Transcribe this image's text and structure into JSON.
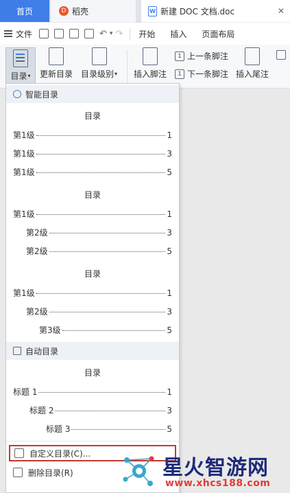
{
  "tabs": {
    "home": "首页",
    "daoke": "稻壳",
    "daoke_logo": "D",
    "doc": "新建 DOC 文档.doc",
    "doc_icon": "W",
    "close": "✕"
  },
  "menubar": {
    "file": "文件",
    "undo": "↶",
    "redo": "↷",
    "dropdown": "▾",
    "start": "开始",
    "insert": "插入",
    "page_layout": "页面布局"
  },
  "ribbon": {
    "toc": "目录",
    "toc_arrow": "▾",
    "update_toc": "更新目录",
    "toc_level": "目录级别",
    "toc_level_arrow": "▾",
    "insert_footnote": "插入脚注",
    "prev_footnote": "上一条脚注",
    "next_footnote": "下一条脚注",
    "insert_endnote": "插入尾注",
    "fn_icon": "1"
  },
  "dropdown": {
    "smart_toc_header": "智能目录",
    "auto_toc_header": "自动目录",
    "sample1": {
      "title": "目录",
      "lines": [
        {
          "label": "第1级",
          "page": "1"
        },
        {
          "label": "第1级",
          "page": "3"
        },
        {
          "label": "第1级",
          "page": "5"
        }
      ]
    },
    "sample2": {
      "title": "目录",
      "lines": [
        {
          "label": "第1级",
          "page": "1"
        },
        {
          "label": "第2级",
          "page": "3"
        },
        {
          "label": "第2级",
          "page": "5"
        }
      ]
    },
    "sample3": {
      "title": "目录",
      "lines": [
        {
          "label": "第1级",
          "page": "1"
        },
        {
          "label": "第2级",
          "page": "3"
        },
        {
          "label": "第3级",
          "page": "5"
        }
      ]
    },
    "auto_sample": {
      "title": "目录",
      "lines": [
        {
          "label": "标题 1",
          "page": "1"
        },
        {
          "label": "标题 2",
          "page": "3"
        },
        {
          "label": "标题 3",
          "page": "5"
        }
      ]
    },
    "custom_toc": "自定义目录(C)...",
    "delete_toc": "删除目录(R)"
  },
  "watermark": {
    "text": "星火智游网",
    "url": "www.xhcs188.com"
  },
  "colors": {
    "accent": "#3f7ee8",
    "highlight_border": "#c0392b",
    "watermark_text": "#1f2b7a",
    "watermark_url": "#e23a3a"
  }
}
